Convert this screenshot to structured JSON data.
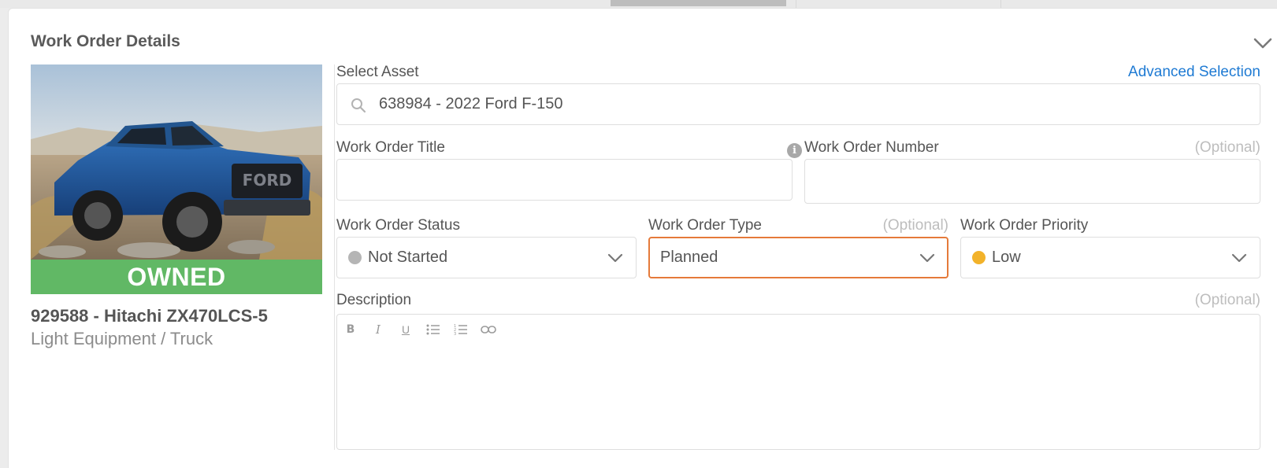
{
  "card": {
    "title": "Work Order Details"
  },
  "asset": {
    "ownership_badge": "OWNED",
    "name": "929588 - Hitachi ZX470LCS-5",
    "category": "Light Equipment / Truck"
  },
  "form": {
    "select_asset": {
      "label": "Select Asset",
      "link": "Advanced Selection",
      "value": "638984 - 2022 Ford F-150"
    },
    "title": {
      "label": "Work Order Title",
      "value": ""
    },
    "number": {
      "label": "Work Order Number",
      "optional": "(Optional)",
      "value": ""
    },
    "status": {
      "label": "Work Order Status",
      "value": "Not Started",
      "dot_color": "#b5b5b5"
    },
    "type": {
      "label": "Work Order Type",
      "optional": "(Optional)",
      "value": "Planned",
      "focus_color": "#e57a3a"
    },
    "priority": {
      "label": "Work Order Priority",
      "value": "Low",
      "dot_color": "#f2b22a"
    },
    "description": {
      "label": "Description",
      "optional": "(Optional)",
      "value": "",
      "toolbar": [
        "bold-icon",
        "italic-icon",
        "underline-icon",
        "bullet-list-icon",
        "numbered-list-icon",
        "link-icon"
      ]
    }
  },
  "colors": {
    "accent_link": "#1e7ad3",
    "owned_green": "#61b865"
  }
}
